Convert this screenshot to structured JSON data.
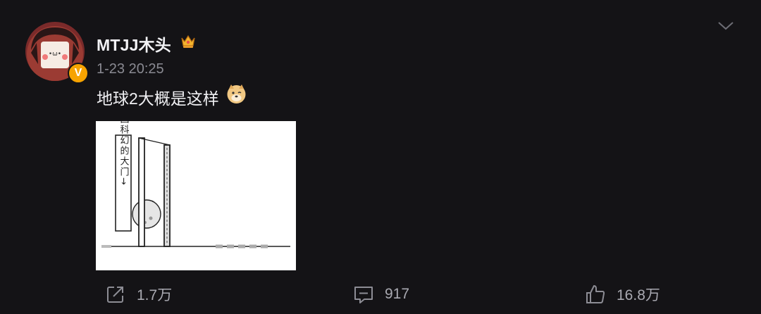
{
  "post": {
    "username": "MTJJ木头",
    "timestamp": "1-23 20:25",
    "text": "地球2大概是这样",
    "image_caption": "中国科幻的大门→"
  },
  "actions": {
    "share_count": "1.7万",
    "comment_count": "917",
    "like_count": "16.8万"
  },
  "icons": {
    "badge": "verified-v-icon",
    "crown": "crown-icon",
    "emoji": "doge-emoji",
    "menu": "chevron-down-icon",
    "share": "share-icon",
    "comment": "comment-icon",
    "like": "thumbs-up-icon"
  },
  "colors": {
    "background": "#141316",
    "badge": "#f7a300",
    "muted_text": "#8a8a92"
  }
}
